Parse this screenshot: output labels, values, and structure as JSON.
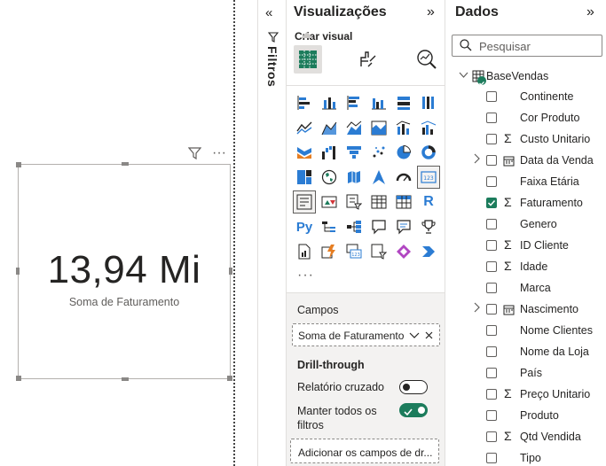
{
  "canvas": {
    "card": {
      "value": "13,94 Mi",
      "label": "Soma de Faturamento"
    },
    "toolbar": {
      "filter_icon": "filter-icon",
      "more_icon": "more-options-icon",
      "more_glyph": "···"
    }
  },
  "filters": {
    "label": "Filtros",
    "collapse_glyph": "«"
  },
  "visualizations": {
    "title": "Visualizações",
    "expand_glyph": "»",
    "build_visual_label": "Criar visual",
    "more_label": "···",
    "fields_section": {
      "label": "Campos",
      "well_value": "Soma de Faturamento"
    },
    "drillthrough": {
      "title": "Drill-through",
      "cross_report_label": "Relatório cruzado",
      "cross_report_on": false,
      "keep_filters_label_1": "Manter todos os",
      "keep_filters_label_2": "filtros",
      "keep_filters_on": true,
      "add_fields_placeholder": "Adicionar os campos de dr..."
    }
  },
  "data_pane": {
    "title": "Dados",
    "expand_glyph": "»",
    "search_placeholder": "Pesquisar",
    "table_name": "BaseVendas",
    "fields": [
      {
        "name": "Continente",
        "checked": false,
        "sigma": false,
        "expandable": false,
        "date": false
      },
      {
        "name": "Cor Produto",
        "checked": false,
        "sigma": false,
        "expandable": false,
        "date": false
      },
      {
        "name": "Custo Unitario",
        "checked": false,
        "sigma": true,
        "expandable": false,
        "date": false
      },
      {
        "name": "Data da Venda",
        "checked": false,
        "sigma": false,
        "expandable": true,
        "date": true
      },
      {
        "name": "Faixa Etária",
        "checked": false,
        "sigma": false,
        "expandable": false,
        "date": false
      },
      {
        "name": "Faturamento",
        "checked": true,
        "sigma": true,
        "expandable": false,
        "date": false
      },
      {
        "name": "Genero",
        "checked": false,
        "sigma": false,
        "expandable": false,
        "date": false
      },
      {
        "name": "ID Cliente",
        "checked": false,
        "sigma": true,
        "expandable": false,
        "date": false
      },
      {
        "name": "Idade",
        "checked": false,
        "sigma": true,
        "expandable": false,
        "date": false
      },
      {
        "name": "Marca",
        "checked": false,
        "sigma": false,
        "expandable": false,
        "date": false
      },
      {
        "name": "Nascimento",
        "checked": false,
        "sigma": false,
        "expandable": true,
        "date": true
      },
      {
        "name": "Nome Clientes",
        "checked": false,
        "sigma": false,
        "expandable": false,
        "date": false
      },
      {
        "name": "Nome da Loja",
        "checked": false,
        "sigma": false,
        "expandable": false,
        "date": false
      },
      {
        "name": "País",
        "checked": false,
        "sigma": false,
        "expandable": false,
        "date": false
      },
      {
        "name": "Preço Unitario",
        "checked": false,
        "sigma": true,
        "expandable": false,
        "date": false
      },
      {
        "name": "Produto",
        "checked": false,
        "sigma": false,
        "expandable": false,
        "date": false
      },
      {
        "name": "Qtd Vendida",
        "checked": false,
        "sigma": true,
        "expandable": false,
        "date": false
      },
      {
        "name": "Tipo",
        "checked": false,
        "sigma": false,
        "expandable": false,
        "date": false
      }
    ]
  },
  "colors": {
    "accent_green": "#1c7c5c",
    "icon_blue": "#2b7cd3",
    "icon_dark": "#252423"
  }
}
